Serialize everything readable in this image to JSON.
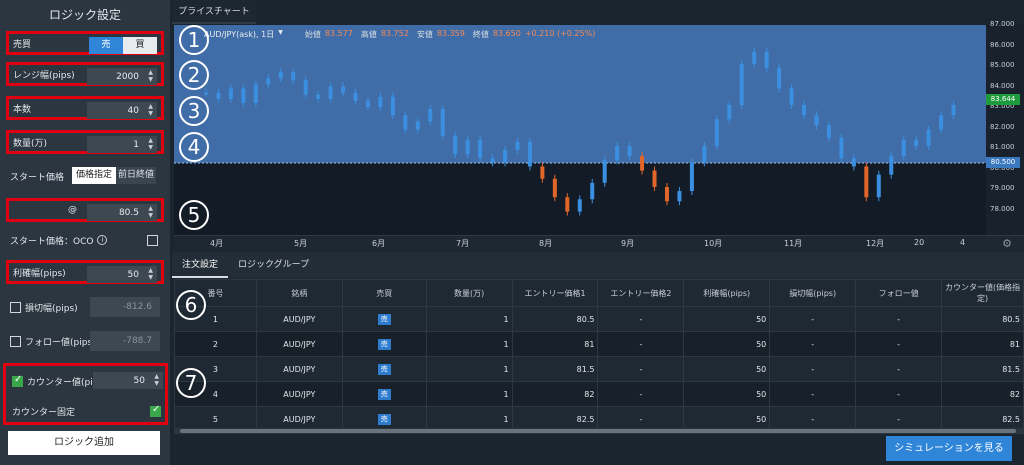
{
  "left": {
    "title": "ロジック設定",
    "side": {
      "label": "売買",
      "sell": "売",
      "buy": "買"
    },
    "range": {
      "label": "レンジ幅(pips)",
      "value": "2000"
    },
    "count": {
      "label": "本数",
      "value": "40"
    },
    "qty": {
      "label": "数量(万)",
      "value": "1"
    },
    "start": {
      "label": "スタート価格",
      "price_btn": "価格指定",
      "prev_btn": "前日終値"
    },
    "at": {
      "label": "@",
      "value": "80.5"
    },
    "oco": {
      "label": "スタート価格：OCO"
    },
    "profit": {
      "label": "利確幅(pips)",
      "value": "50"
    },
    "stop": {
      "label": "損切幅(pips)",
      "value": "-812.6"
    },
    "follow": {
      "label": "フォロー値(pips)",
      "value": "-788.7"
    },
    "counter": {
      "label": "カウンター値(pips)",
      "value": "50"
    },
    "counter_fixed": {
      "label": "カウンター固定"
    },
    "add_button": "ロジック追加"
  },
  "chart": {
    "tab": "プライスチャート",
    "symbol": "AUD/JPY(ask), 1日",
    "ohlc": [
      {
        "k": "始値",
        "v": "83.577"
      },
      {
        "k": "高値",
        "v": "83.752"
      },
      {
        "k": "安値",
        "v": "83.359"
      },
      {
        "k": "終値",
        "v": "83.650"
      }
    ],
    "change": "+0.210 (+0.25%)",
    "yticks": [
      "87.000",
      "86.000",
      "85.000",
      "84.000",
      "83.000",
      "82.000",
      "81.000",
      "80.000",
      "79.000",
      "78.000"
    ],
    "price_tag": "83.644",
    "start_tag": "80.500",
    "xticks": [
      "4月",
      "5月",
      "6月",
      "7月",
      "8月",
      "9月",
      "10月",
      "11月",
      "12月",
      "20",
      "4"
    ],
    "colors": {
      "up": "#3b8fe0",
      "down": "#e0662a",
      "highlight": "#4a7fc4"
    }
  },
  "chart_data": {
    "type": "line",
    "series": [
      {
        "values": [
          84.2,
          83.9,
          84.4,
          83.7,
          84.6,
          84.9,
          85.2,
          84.8,
          84.1,
          83.9,
          84.5,
          84.2,
          83.8,
          83.5,
          84.0,
          83.1,
          82.4,
          82.8,
          83.4,
          82.1,
          81.2,
          81.9,
          81.0,
          80.8,
          81.4,
          81.8,
          80.6,
          80.0,
          79.1,
          78.4,
          79.0,
          79.8,
          80.9,
          81.6,
          81.1,
          80.4,
          79.6,
          78.9,
          79.4,
          80.8,
          81.6,
          82.9,
          83.6,
          85.6,
          86.2,
          85.4,
          84.4,
          83.6,
          83.1,
          82.6,
          82.0,
          81.0,
          80.6,
          79.1,
          80.2,
          81.1,
          81.9,
          81.6,
          82.4,
          83.1,
          83.6
        ]
      }
    ]
  },
  "annot": [
    "1",
    "2",
    "3",
    "4",
    "5",
    "6",
    "7"
  ],
  "tabs": [
    "注文設定",
    "ロジックグループ"
  ],
  "table": {
    "headers": [
      "番号",
      "銘柄",
      "売買",
      "数量(万)",
      "エントリー価格1",
      "エントリー価格2",
      "利確幅(pips)",
      "損切幅(pips)",
      "フォロー値",
      "カウンター値(価格指定)"
    ],
    "rows": [
      [
        "1",
        "AUD/JPY",
        "売",
        "1",
        "80.5",
        "-",
        "50",
        "-",
        "-",
        "80.5"
      ],
      [
        "2",
        "AUD/JPY",
        "売",
        "1",
        "81",
        "-",
        "50",
        "-",
        "-",
        "81"
      ],
      [
        "3",
        "AUD/JPY",
        "売",
        "1",
        "81.5",
        "-",
        "50",
        "-",
        "-",
        "81.5"
      ],
      [
        "4",
        "AUD/JPY",
        "売",
        "1",
        "82",
        "-",
        "50",
        "-",
        "-",
        "82"
      ],
      [
        "5",
        "AUD/JPY",
        "売",
        "1",
        "82.5",
        "-",
        "50",
        "-",
        "-",
        "82.5"
      ]
    ]
  },
  "sim_button": "シミュレーションを見る"
}
